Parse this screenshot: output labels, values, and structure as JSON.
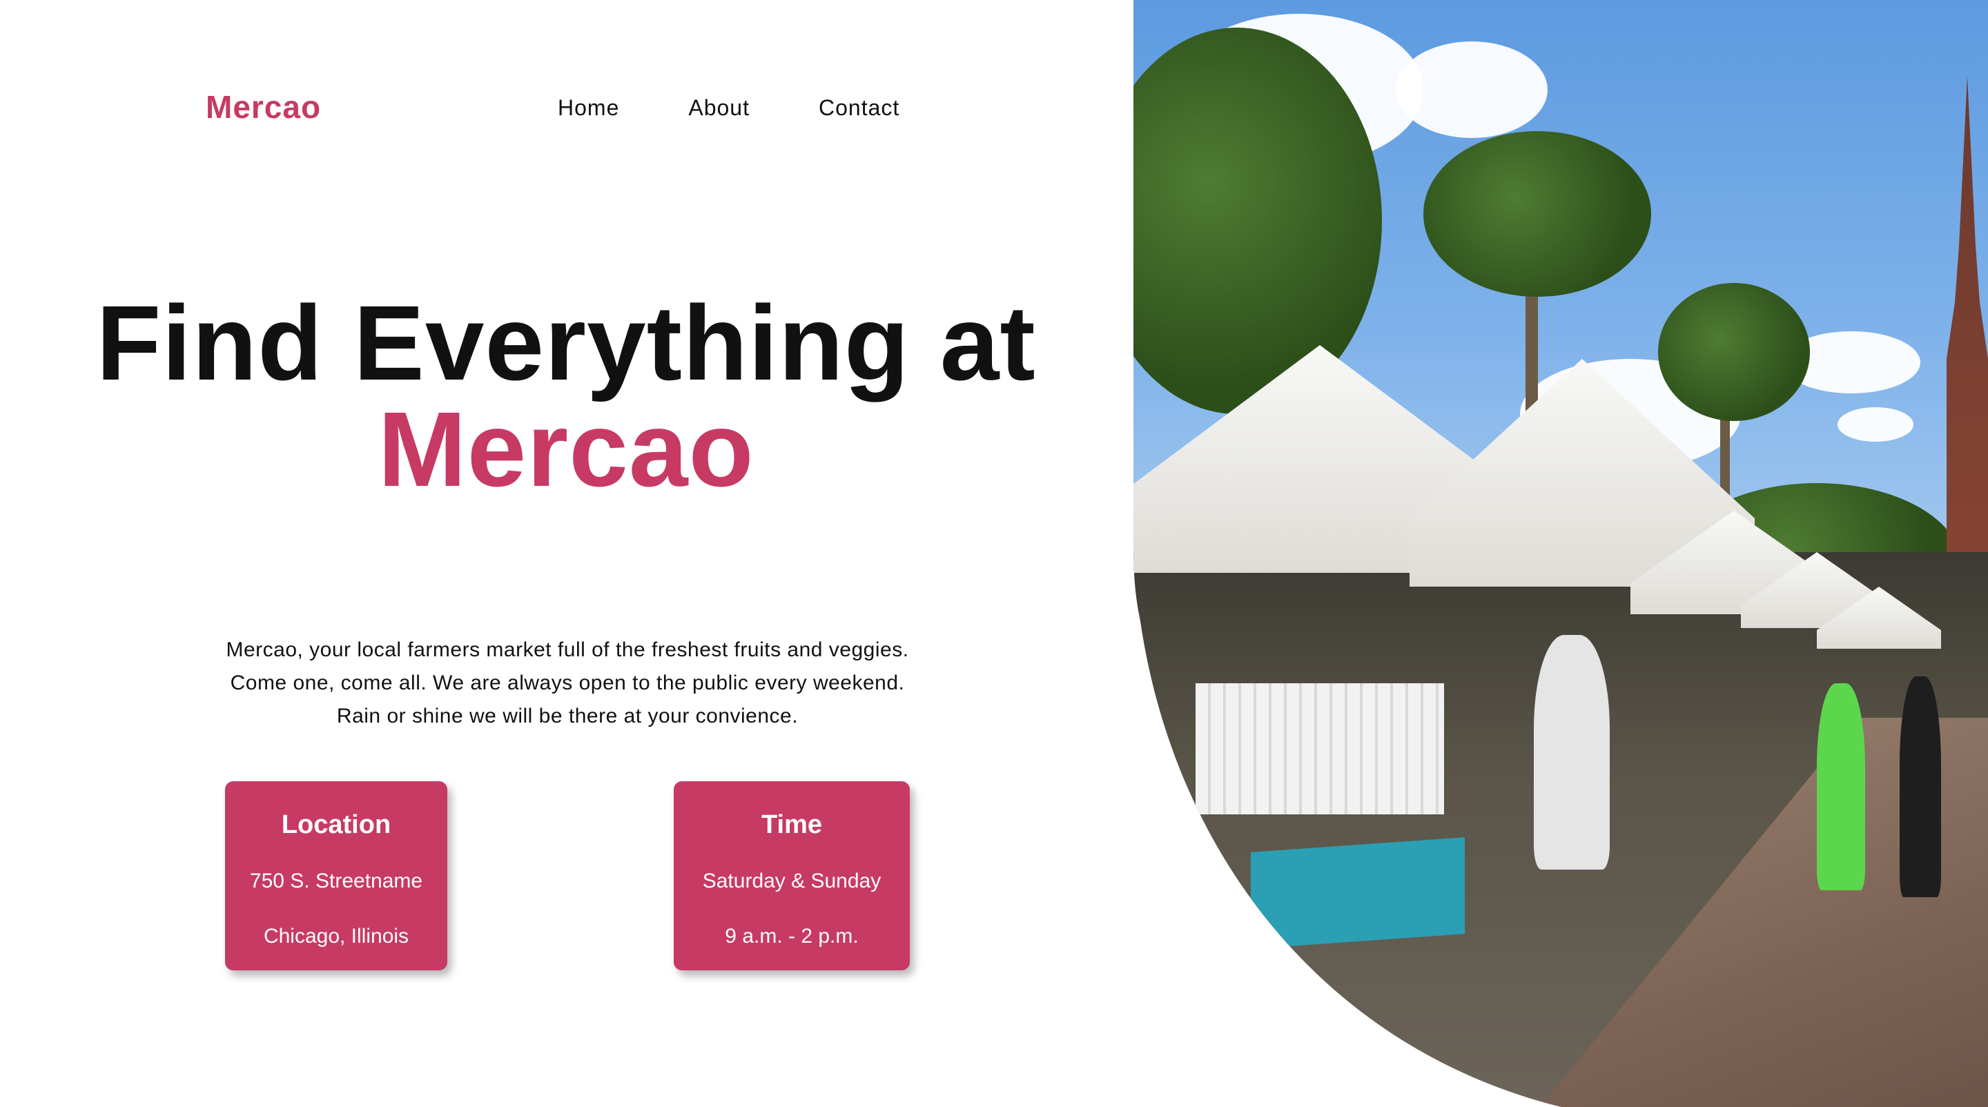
{
  "header": {
    "brand": "Mercao",
    "nav": [
      {
        "label": "Home"
      },
      {
        "label": "About"
      },
      {
        "label": "Contact"
      }
    ]
  },
  "hero": {
    "title_line1": "Find Everything at",
    "title_line2": "Mercao",
    "intro": "Mercao, your local farmers market full of the freshest fruits and veggies. Come one, come all. We are always open to the public every weekend. Rain or shine we will be there at your convience."
  },
  "cards": {
    "location": {
      "title": "Location",
      "line1": "750 S. Streetname",
      "line2": "Chicago, Illinois"
    },
    "time": {
      "title": "Time",
      "line1": "Saturday & Sunday",
      "line2": "9 a.m. - 2 p.m."
    }
  },
  "colors": {
    "accent": "#c73a64",
    "text": "#111111",
    "background": "#ffffff"
  },
  "image": {
    "subject": "outdoor-farmers-market-photo"
  }
}
